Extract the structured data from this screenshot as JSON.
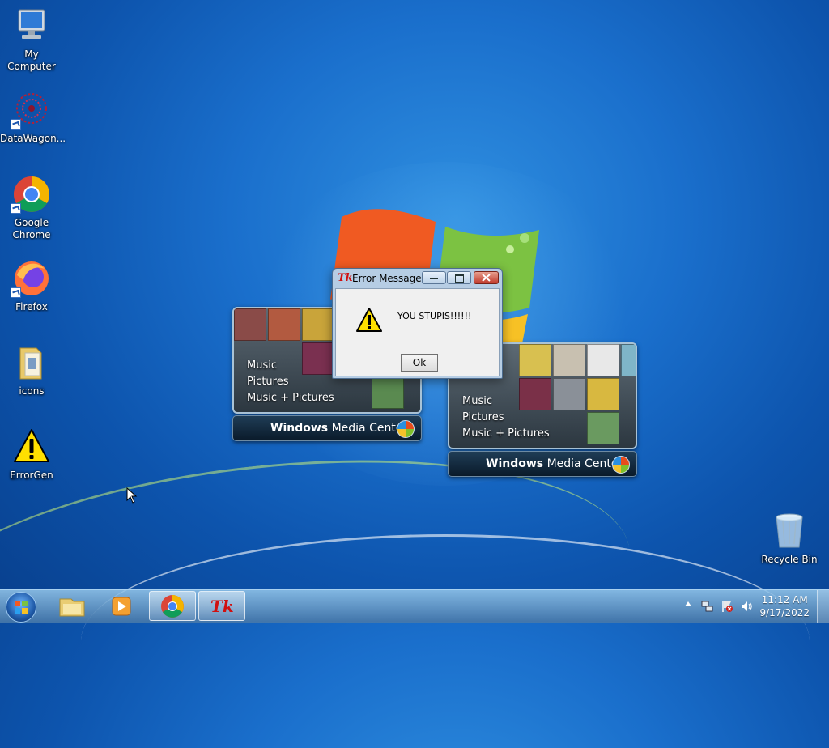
{
  "desktop": {
    "icons": [
      {
        "label": "My Computer",
        "icon": "computer-icon"
      },
      {
        "label": "DataWagon...",
        "icon": "datawagon-icon"
      },
      {
        "label": "Google Chrome",
        "icon": "chrome-icon"
      },
      {
        "label": "Firefox",
        "icon": "firefox-icon"
      },
      {
        "label": "icons",
        "icon": "folder-icon"
      },
      {
        "label": "ErrorGen",
        "icon": "warning-icon"
      },
      {
        "label": "Recycle Bin",
        "icon": "recycle-bin-icon"
      }
    ]
  },
  "wmc": {
    "menu": [
      "Music",
      "Pictures",
      "Music + Pictures"
    ],
    "bar_bold": "Windows",
    "bar_rest": "Media Center"
  },
  "dialog": {
    "title": "Error Message",
    "tk_logo": "Tk",
    "message": "YOU STUPIS!!!!!!",
    "ok_label": "Ok"
  },
  "taskbar": {
    "tk_label": "Tk",
    "time": "11:12 AM",
    "date": "9/17/2022"
  },
  "colors": {
    "wallpaper": "#1a6fcc",
    "dialog_frame": "#b6cde4",
    "close_button": "#c0392b"
  }
}
